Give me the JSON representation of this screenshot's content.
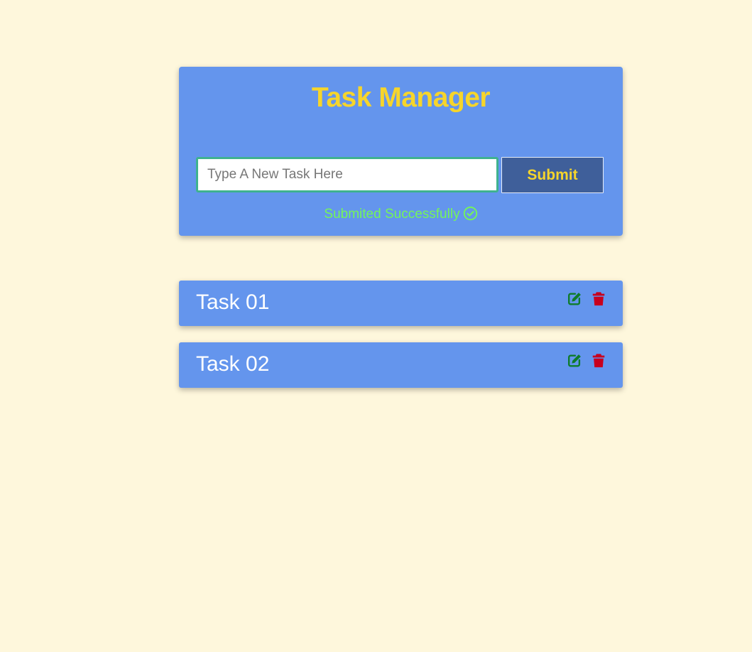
{
  "app": {
    "title": "Task Manager"
  },
  "form": {
    "input_value": "",
    "input_placeholder": "Type A New Task Here",
    "submit_label": "Submit",
    "status_text": "Submited Successfully",
    "status_icon": "check-circle-icon"
  },
  "tasks": [
    {
      "label": "Task 01",
      "edit_icon": "edit-icon",
      "delete_icon": "trash-icon"
    },
    {
      "label": "Task 02",
      "edit_icon": "edit-icon",
      "delete_icon": "trash-icon"
    }
  ],
  "colors": {
    "page_background": "#fef7dc",
    "card_background": "#6495ed",
    "title": "#f6d52b",
    "submit_button": "#3f5f9a",
    "submit_text": "#f6d52b",
    "input_border": "#3fb28f",
    "status_text": "#74f55a",
    "task_text": "#ffffff",
    "edit_icon": "#0e7b2b",
    "delete_icon": "#c8001e"
  }
}
